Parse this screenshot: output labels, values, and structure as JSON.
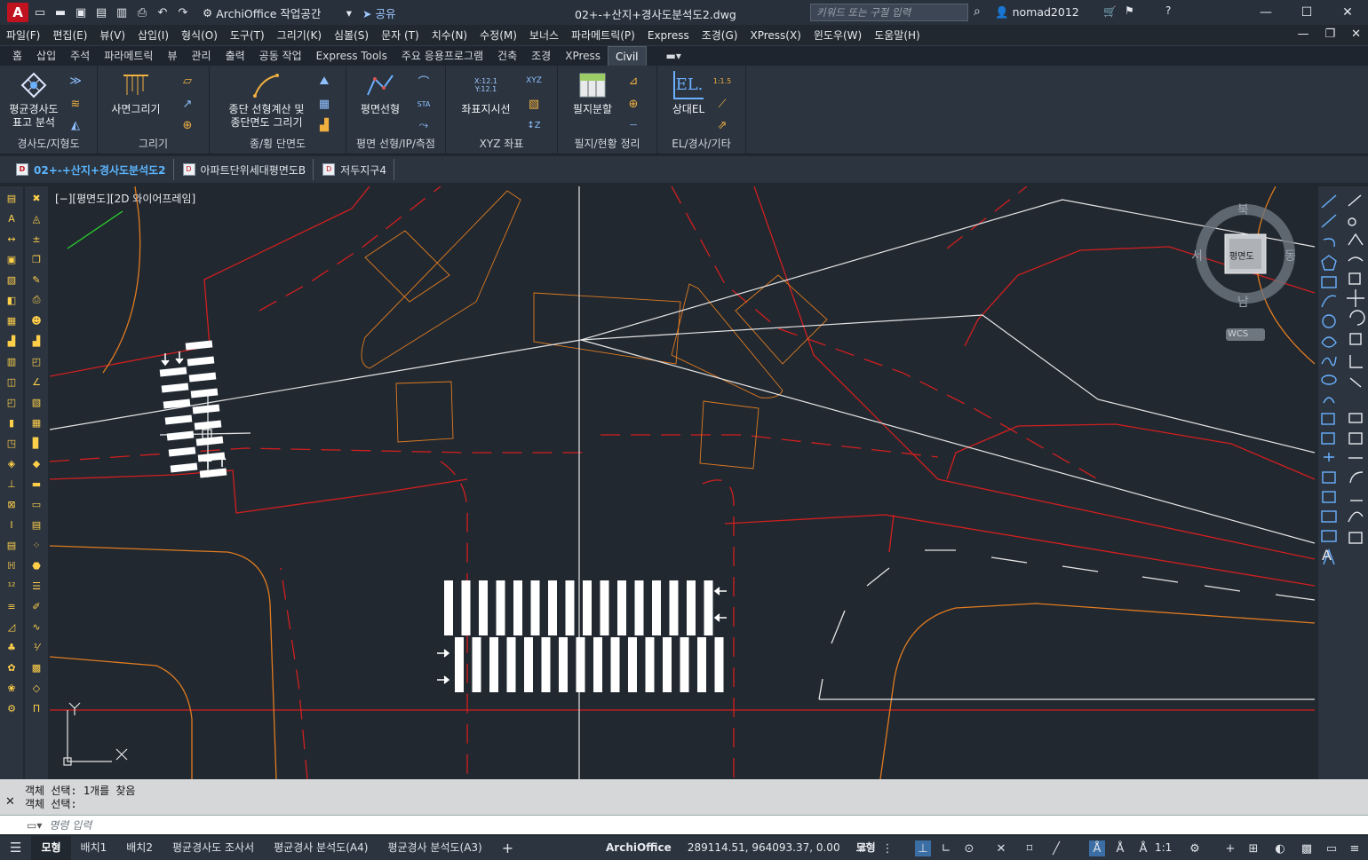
{
  "titlebar": {
    "workspace": "ArchiOffice 작업공간",
    "share": "공유",
    "doc_title": "02+-+산지+경사도분석도2.dwg",
    "search_placeholder": "키워드 또는 구절 입력",
    "user": "nomad2012"
  },
  "menus": [
    "파일(F)",
    "편집(E)",
    "뷰(V)",
    "삽입(I)",
    "형식(O)",
    "도구(T)",
    "그리기(K)",
    "심볼(S)",
    "문자 (T)",
    "치수(N)",
    "수정(M)",
    "보너스",
    "파라메트릭(P)",
    "Express",
    "조경(G)",
    "XPress(X)",
    "윈도우(W)",
    "도움말(H)"
  ],
  "ribbon_tabs": [
    "홈",
    "삽입",
    "주석",
    "파라메트릭",
    "뷰",
    "관리",
    "출력",
    "공동 작업",
    "Express Tools",
    "주요 응용프로그램",
    "건축",
    "조경",
    "XPress",
    "Civil"
  ],
  "ribbon_active": "Civil",
  "panels": {
    "p1": {
      "title": "경사도/지형도",
      "btn1": "평균경사도",
      "btn2": "표고 분석"
    },
    "p2": {
      "title": "그리기",
      "btn1": "사면그리기"
    },
    "p3": {
      "title": "종/횡 단면도",
      "btn1": "종단 선형계산 및",
      "btn2": "종단면도 그리기"
    },
    "p4": {
      "title": "평면 선형/IP/측점",
      "btn1": "평면선형"
    },
    "p5": {
      "title": "XYZ 좌표",
      "btn1": "좌표지시선",
      "ico": "X:12.1 Y:12.1"
    },
    "p6": {
      "title": "필지/현황 정리",
      "btn1": "필지분할"
    },
    "p7": {
      "title": "EL/경사/기타",
      "btn1": "상대EL",
      "ico": "EL."
    }
  },
  "file_tabs": [
    "02+-+산지+경사도분석도2",
    "아파트단위세대평면도B",
    "저두지구4"
  ],
  "viewport_label": "[−][평면도][2D 와이어프레임]",
  "viewcube": {
    "north": "북",
    "south": "남",
    "east": "동",
    "west": "서",
    "face": "평면도",
    "wcs": "WCS"
  },
  "ucs": {
    "x": "X",
    "y": "Y"
  },
  "command_history": [
    "객체 선택: 1개를 찾음",
    "객체 선택:"
  ],
  "command_placeholder": "명령 입력",
  "layout_tabs": [
    "모형",
    "배치1",
    "배치2",
    "평균경사도 조사서",
    "평균경사 분석도(A4)",
    "평균경사 분석도(A3)"
  ],
  "status": {
    "app": "ArchiOffice",
    "coords": "289114.51, 964093.37, 0.00",
    "model": "모형",
    "scale": "1:1"
  }
}
